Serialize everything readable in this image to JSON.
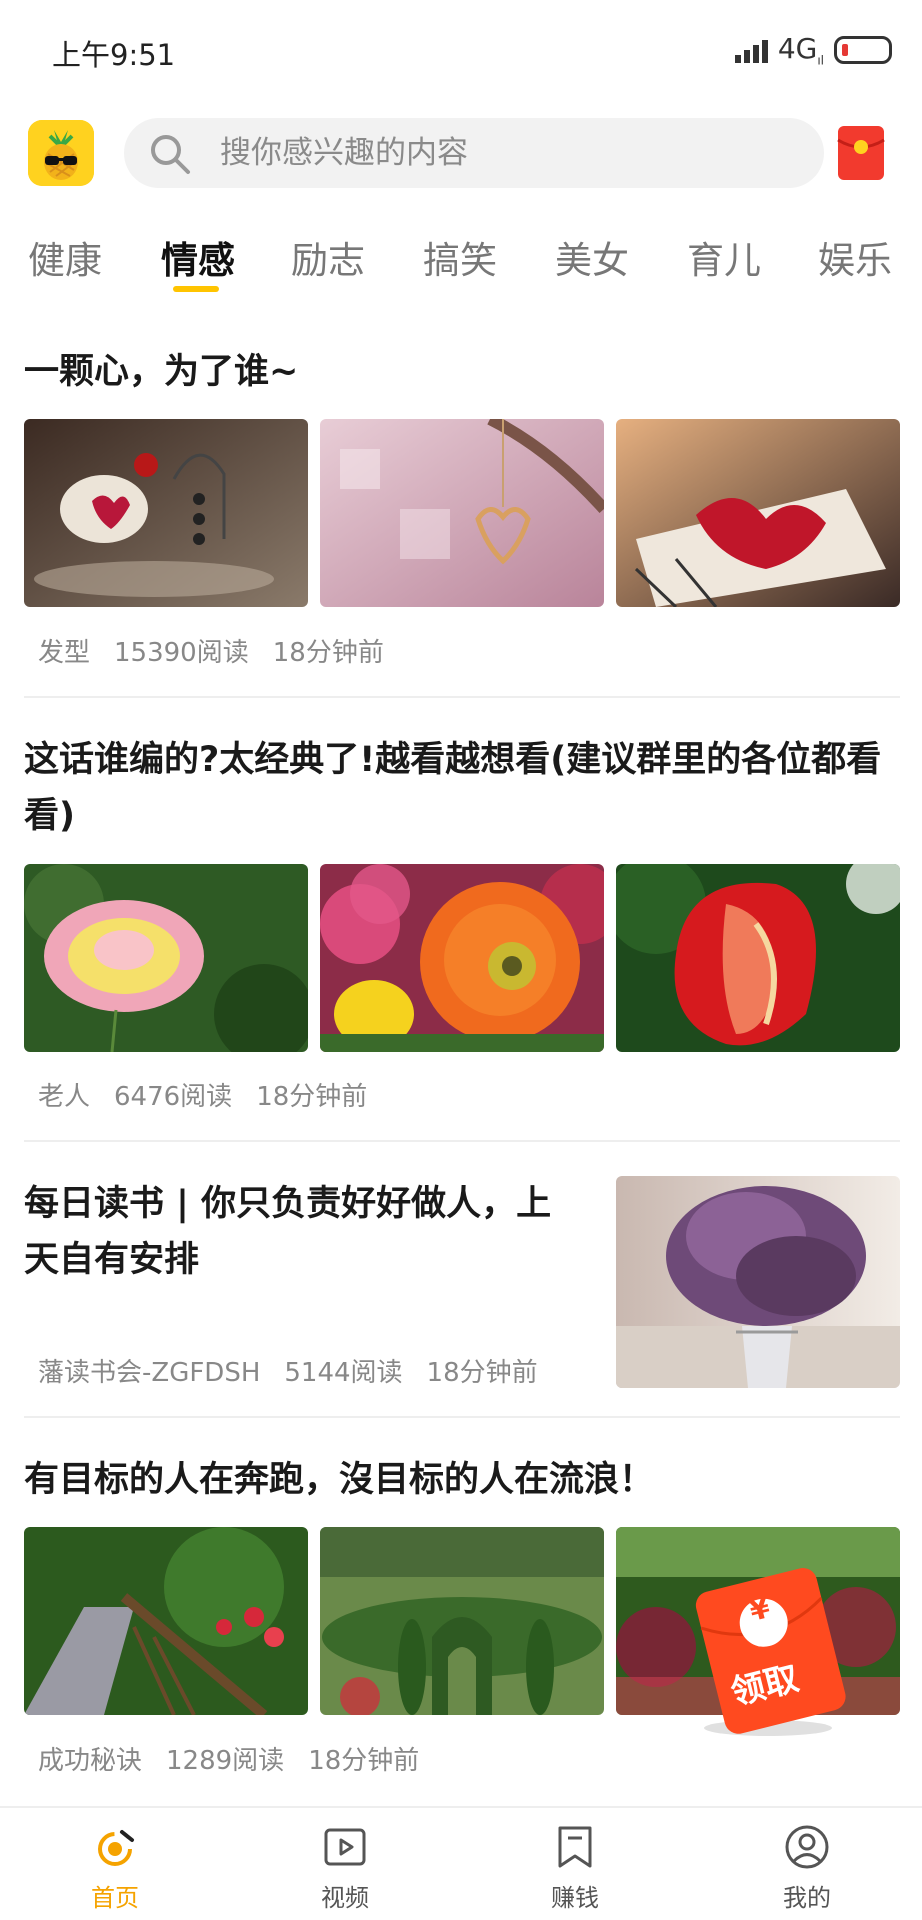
{
  "status_bar": {
    "time": "上午9:51",
    "network": "4G",
    "network_sub": "ıl"
  },
  "header": {
    "search": {
      "placeholder": "搜你感兴趣的内容"
    },
    "logo_icon": "pineapple-sunglasses-logo",
    "redpacket_icon": "red-envelope-icon"
  },
  "tabs": [
    {
      "label": "健康"
    },
    {
      "label": "情感",
      "active": true
    },
    {
      "label": "励志"
    },
    {
      "label": "搞笑"
    },
    {
      "label": "美女"
    },
    {
      "label": "育儿"
    },
    {
      "label": "娱乐"
    }
  ],
  "articles": [
    {
      "title": "一颗心，为了谁~",
      "source": "发型",
      "reads": "15390阅读",
      "time": "18分钟前",
      "images": [
        "teacup-heart",
        "hanging-heart",
        "phone-heart"
      ]
    },
    {
      "title": "这话谁编的?太经典了!越看越想看(建议群里的各位都看看)",
      "source": "老人",
      "reads": "6476阅读",
      "time": "18分钟前",
      "images": [
        "yellow-pink-rose",
        "orange-poppy",
        "red-tulip"
      ]
    },
    {
      "title": "每日读书 | 你只负责好好做人，上天自有安排",
      "source": "藩读书会-ZGFDSH",
      "reads": "5144阅读",
      "time": "18分钟前",
      "images": [
        "lavender-vase"
      ]
    },
    {
      "title": "有目标的人在奔跑，沒目标的人在流浪！",
      "source": "成功秘诀",
      "reads": "1289阅读",
      "time": "18分钟前",
      "images": [
        "garden-bridge",
        "hedge-maze",
        "flower-garden"
      ]
    }
  ],
  "floating_redpacket": {
    "symbol": "¥",
    "label": "领取"
  },
  "bottom_nav": [
    {
      "label": "首页",
      "icon": "home-icon",
      "active": true
    },
    {
      "label": "视频",
      "icon": "video-icon"
    },
    {
      "label": "赚钱",
      "icon": "bookmark-icon"
    },
    {
      "label": "我的",
      "icon": "user-icon"
    }
  ],
  "colors": {
    "accent": "#ffc400",
    "active_nav": "#f5a300",
    "redpacket": "#ff4a1f"
  }
}
